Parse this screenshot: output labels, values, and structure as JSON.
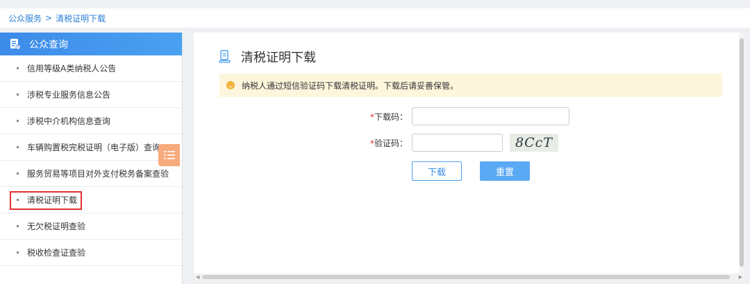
{
  "breadcrumb": {
    "items": [
      "公众服务",
      "清税证明下载"
    ],
    "separator": ">"
  },
  "sidebar": {
    "header": "公众查询",
    "header_icon": "document-icon",
    "items": [
      {
        "label": "信用等级A类纳税人公告"
      },
      {
        "label": "涉税专业服务信息公告"
      },
      {
        "label": "涉税中介机构信息查询"
      },
      {
        "label": "车辆购置税完税证明（电子版）查询"
      },
      {
        "label": "服务贸易等项目对外支付税务备案查验"
      },
      {
        "label": "清税证明下载",
        "active": true
      },
      {
        "label": "无欠税证明查验"
      },
      {
        "label": "税收检查证查验"
      }
    ]
  },
  "main": {
    "title": "清税证明下载",
    "title_icon": "receipt-icon",
    "notice": "纳税人通过短信验证码下载清税证明。下载后请妥善保管。",
    "form": {
      "download_code_label": "下载码：",
      "download_code_value": "",
      "captcha_label": "验证码：",
      "captcha_value": "",
      "captcha_text": "8CcT",
      "required_mark": "*"
    },
    "buttons": {
      "download": "下载",
      "reset": "重置"
    }
  },
  "colors": {
    "accent": "#3d8be9",
    "notice_bg": "#fdf6dc",
    "active_border": "#e0302e",
    "float_button": "#f7ab7c"
  }
}
